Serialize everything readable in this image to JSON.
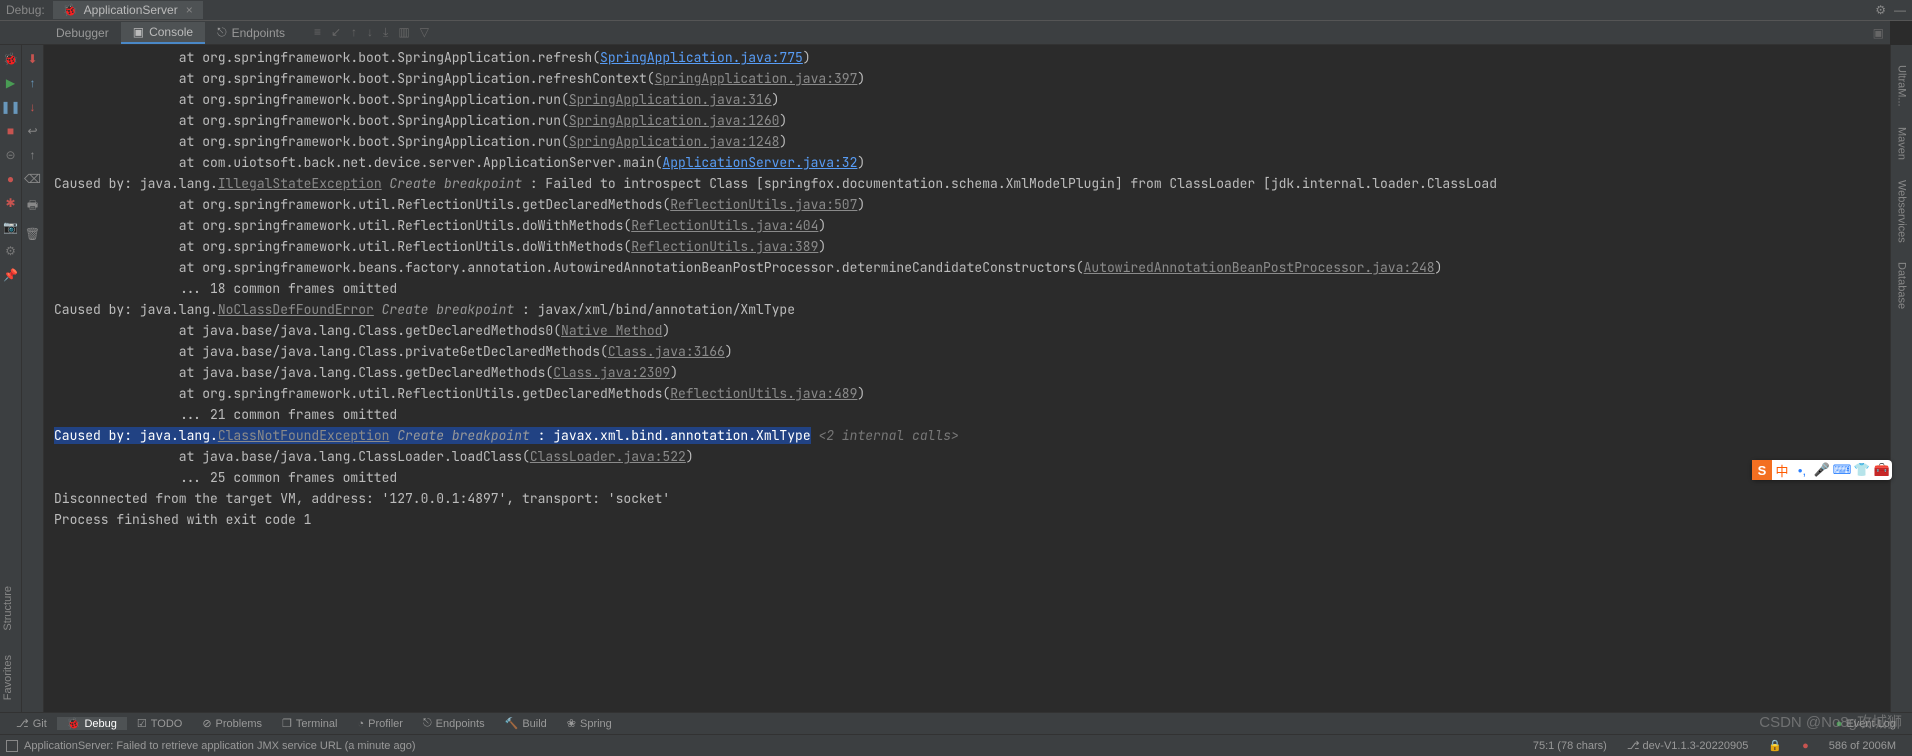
{
  "topbar": {
    "debug_label": "Debug:",
    "tab_name": "ApplicationServer"
  },
  "panel_tabs": {
    "debugger": "Debugger",
    "console": "Console",
    "endpoints": "Endpoints"
  },
  "right_rail": [
    "UltraM...",
    "Maven",
    "Webservices",
    "Database"
  ],
  "left_side": [
    "Structure",
    "Favorites"
  ],
  "console_lines": [
    {
      "indent": 4,
      "t": "at",
      "text": "at org.springframework.boot.SpringApplication.refresh(",
      "link": "SpringApplication.java:775",
      "blue": true,
      "tail": ")"
    },
    {
      "indent": 4,
      "t": "at",
      "text": "at org.springframework.boot.SpringApplication.refreshContext(",
      "link": "SpringApplication.java:397",
      "tail": ")"
    },
    {
      "indent": 4,
      "t": "at",
      "text": "at org.springframework.boot.SpringApplication.run(",
      "link": "SpringApplication.java:316",
      "tail": ")"
    },
    {
      "indent": 4,
      "t": "at",
      "text": "at org.springframework.boot.SpringApplication.run(",
      "link": "SpringApplication.java:1260",
      "tail": ")"
    },
    {
      "indent": 4,
      "t": "at",
      "text": "at org.springframework.boot.SpringApplication.run(",
      "link": "SpringApplication.java:1248",
      "tail": ")"
    },
    {
      "indent": 4,
      "t": "at",
      "text": "at com.uiotsoft.back.net.device.server.ApplicationServer.main(",
      "link": "ApplicationServer.java:32",
      "blue": true,
      "tail": ")"
    },
    {
      "indent": 0,
      "t": "caused",
      "pre": "Caused by: java.lang.",
      "exc": "IllegalStateException",
      "bp": " Create breakpoint ",
      "post": ": Failed to introspect Class [springfox.documentation.schema.XmlModelPlugin] from ClassLoader [jdk.internal.loader.ClassLoad"
    },
    {
      "indent": 4,
      "t": "at",
      "text": "at org.springframework.util.ReflectionUtils.getDeclaredMethods(",
      "link": "ReflectionUtils.java:507",
      "tail": ")"
    },
    {
      "indent": 4,
      "t": "at",
      "text": "at org.springframework.util.ReflectionUtils.doWithMethods(",
      "link": "ReflectionUtils.java:404",
      "tail": ")"
    },
    {
      "indent": 4,
      "t": "at",
      "text": "at org.springframework.util.ReflectionUtils.doWithMethods(",
      "link": "ReflectionUtils.java:389",
      "tail": ")"
    },
    {
      "indent": 4,
      "t": "at",
      "text": "at org.springframework.beans.factory.annotation.AutowiredAnnotationBeanPostProcessor.determineCandidateConstructors(",
      "link": "AutowiredAnnotationBeanPostProcessor.java:248",
      "tail": ")"
    },
    {
      "indent": 4,
      "t": "plain",
      "text": "... 18 common frames omitted"
    },
    {
      "indent": 0,
      "t": "caused",
      "pre": "Caused by: java.lang.",
      "exc": "NoClassDefFoundError",
      "bp": " Create breakpoint ",
      "post": ": javax/xml/bind/annotation/XmlType"
    },
    {
      "indent": 4,
      "t": "at",
      "text": "at java.base/java.lang.Class.getDeclaredMethods0(",
      "link": "Native Method",
      "tail": ")"
    },
    {
      "indent": 4,
      "t": "at",
      "text": "at java.base/java.lang.Class.privateGetDeclaredMethods(",
      "link": "Class.java:3166",
      "tail": ")"
    },
    {
      "indent": 4,
      "t": "at",
      "text": "at java.base/java.lang.Class.getDeclaredMethods(",
      "link": "Class.java:2309",
      "tail": ")"
    },
    {
      "indent": 4,
      "t": "at",
      "text": "at org.springframework.util.ReflectionUtils.getDeclaredMethods(",
      "link": "ReflectionUtils.java:489",
      "tail": ")"
    },
    {
      "indent": 4,
      "t": "plain",
      "text": "... 21 common frames omitted"
    },
    {
      "indent": 0,
      "t": "caused_hl",
      "pre": "Caused by: java.lang.",
      "exc": "ClassNotFoundException",
      "bp": " Create breakpoint ",
      "post": ": javax.xml.bind.annotation.XmlType",
      "internal": " <2 internal calls>"
    },
    {
      "indent": 4,
      "t": "at",
      "text": "at java.base/java.lang.ClassLoader.loadClass(",
      "link": "ClassLoader.java:522",
      "tail": ")"
    },
    {
      "indent": 4,
      "t": "plain",
      "text": "... 25 common frames omitted"
    },
    {
      "indent": 0,
      "t": "plain",
      "text": "Disconnected from the target VM, address: '127.0.0.1:4897', transport: 'socket'"
    },
    {
      "indent": 0,
      "t": "plain",
      "text": ""
    },
    {
      "indent": 0,
      "t": "plain",
      "text": "Process finished with exit code 1"
    }
  ],
  "bottom_tools": {
    "git": "Git",
    "debug": "Debug",
    "todo": "TODO",
    "problems": "Problems",
    "terminal": "Terminal",
    "profiler": "Profiler",
    "endpoints": "Endpoints",
    "build": "Build",
    "spring": "Spring"
  },
  "watermark": "CSDN @No8g攻城狮",
  "statusbar": {
    "message": "ApplicationServer: Failed to retrieve application JMX service URL (a minute ago)",
    "cursor": "75:1 (78 chars)",
    "branch": "dev-V1.1.3-20220905",
    "heap": "586 of 2006M",
    "event": "Event Log"
  },
  "ime": {
    "cn": "中"
  }
}
